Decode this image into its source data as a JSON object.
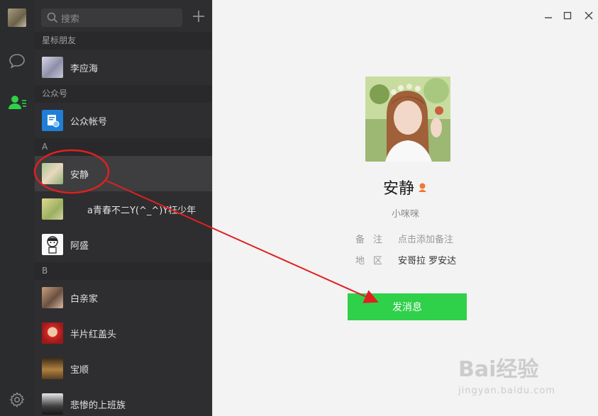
{
  "search": {
    "placeholder": "搜索"
  },
  "sections": {
    "starred": "星标朋友",
    "official": "公众号",
    "a": "A",
    "b": "B"
  },
  "contacts": {
    "starred_1": "李应海",
    "official_1": "公众帐号",
    "a_1": "安静",
    "a_2": "a青春不二Y(^_^)Y枉少年",
    "a_3": "阿盛",
    "b_1": "白亲家",
    "b_2": "半片红盖头",
    "b_3": "宝顺",
    "b_4": "悲惨的上班族"
  },
  "profile": {
    "name": "安静",
    "nickname": "小咪咪",
    "remark_label": "备注",
    "remark_value": "点击添加备注",
    "region_label": "地区",
    "region_value": "安哥拉 罗安达",
    "send_button": "发消息"
  },
  "colors": {
    "accent": "#2fd04a",
    "annotation": "#e02020",
    "rail": "#2b2c2e",
    "list": "#2e2e30"
  },
  "watermark": {
    "main": "Bai经验",
    "sub": "jingyan.baidu.com"
  },
  "icons": {
    "chat": "chat-bubble-icon",
    "contacts": "contacts-icon",
    "settings": "gear-icon",
    "search": "search-icon",
    "add": "plus-icon",
    "gender": "female-icon"
  }
}
